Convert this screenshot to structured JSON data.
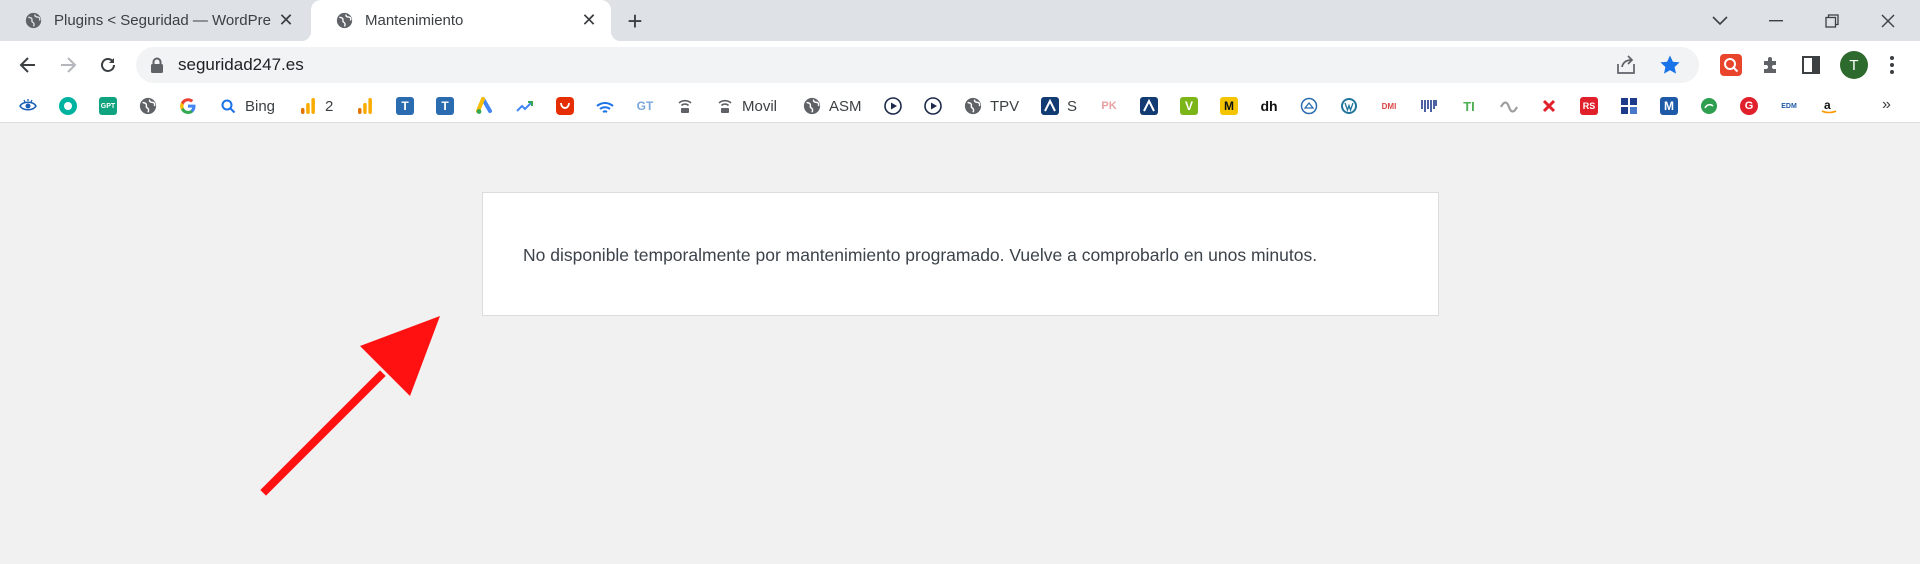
{
  "browser": {
    "tabs": [
      {
        "label": "Plugins < Seguridad — WordPre",
        "active": false
      },
      {
        "label": "Mantenimiento",
        "active": true
      }
    ],
    "new_tab_label": "+",
    "url": "seguridad247.es",
    "avatar_initial": "T",
    "colors": {
      "star": "#1a73e8",
      "avatar": "#2d6a2d",
      "tabstrip": "#dee1e6"
    }
  },
  "bookmarks": [
    {
      "label": "",
      "icon": "eye-icon"
    },
    {
      "label": "",
      "icon": "teal-ring-icon"
    },
    {
      "label": "",
      "icon": "gpt-icon",
      "text": "GPT"
    },
    {
      "label": "",
      "icon": "globe-icon"
    },
    {
      "label": "",
      "icon": "google-icon"
    },
    {
      "label": "Bing",
      "icon": "search-icon"
    },
    {
      "label": "2",
      "icon": "analytics-icon"
    },
    {
      "label": "",
      "icon": "analytics-icon"
    },
    {
      "label": "",
      "icon": "t-blue-icon"
    },
    {
      "label": "",
      "icon": "t-blue-icon"
    },
    {
      "label": "",
      "icon": "google-ads-icon"
    },
    {
      "label": "",
      "icon": "trend-icon"
    },
    {
      "label": "",
      "icon": "aliexpress-icon"
    },
    {
      "label": "",
      "icon": "wifi-icon"
    },
    {
      "label": "",
      "icon": "gt-icon",
      "text": "GT"
    },
    {
      "label": "",
      "icon": "router-icon"
    },
    {
      "label": "Movil",
      "icon": "router-icon"
    },
    {
      "label": "ASM",
      "icon": "globe-icon"
    },
    {
      "label": "",
      "icon": "play-icon"
    },
    {
      "label": "",
      "icon": "play-icon"
    },
    {
      "label": "TPV",
      "icon": "globe-icon"
    },
    {
      "label": "S",
      "icon": "a-navy-icon"
    },
    {
      "label": "",
      "icon": "pk-icon"
    },
    {
      "label": "",
      "icon": "a-navy-icon"
    },
    {
      "label": "",
      "icon": "v-green-icon"
    },
    {
      "label": "",
      "icon": "m-yellow-icon"
    },
    {
      "label": "",
      "icon": "dh-icon"
    },
    {
      "label": "",
      "icon": "shield-outline-icon"
    },
    {
      "label": "",
      "icon": "wordpress-icon"
    },
    {
      "label": "",
      "icon": "dmi-icon"
    },
    {
      "label": "",
      "icon": "barcode-icon"
    },
    {
      "label": "",
      "icon": "ti-icon"
    },
    {
      "label": "",
      "icon": "wave-icon"
    },
    {
      "label": "",
      "icon": "x-red-icon"
    },
    {
      "label": "",
      "icon": "rs-icon"
    },
    {
      "label": "",
      "icon": "grid-blue-icon"
    },
    {
      "label": "",
      "icon": "m-blue-icon"
    },
    {
      "label": "",
      "icon": "green-circle-icon"
    },
    {
      "label": "",
      "icon": "g-red-icon"
    },
    {
      "label": "",
      "icon": "edm-icon"
    },
    {
      "label": "",
      "icon": "amazon-icon"
    }
  ],
  "bookmarks_overflow": "»",
  "page": {
    "message": "No disponible temporalmente por mantenimiento programado. Vuelve a comprobarlo en unos minutos.",
    "annotation_color": "#ff0000"
  }
}
